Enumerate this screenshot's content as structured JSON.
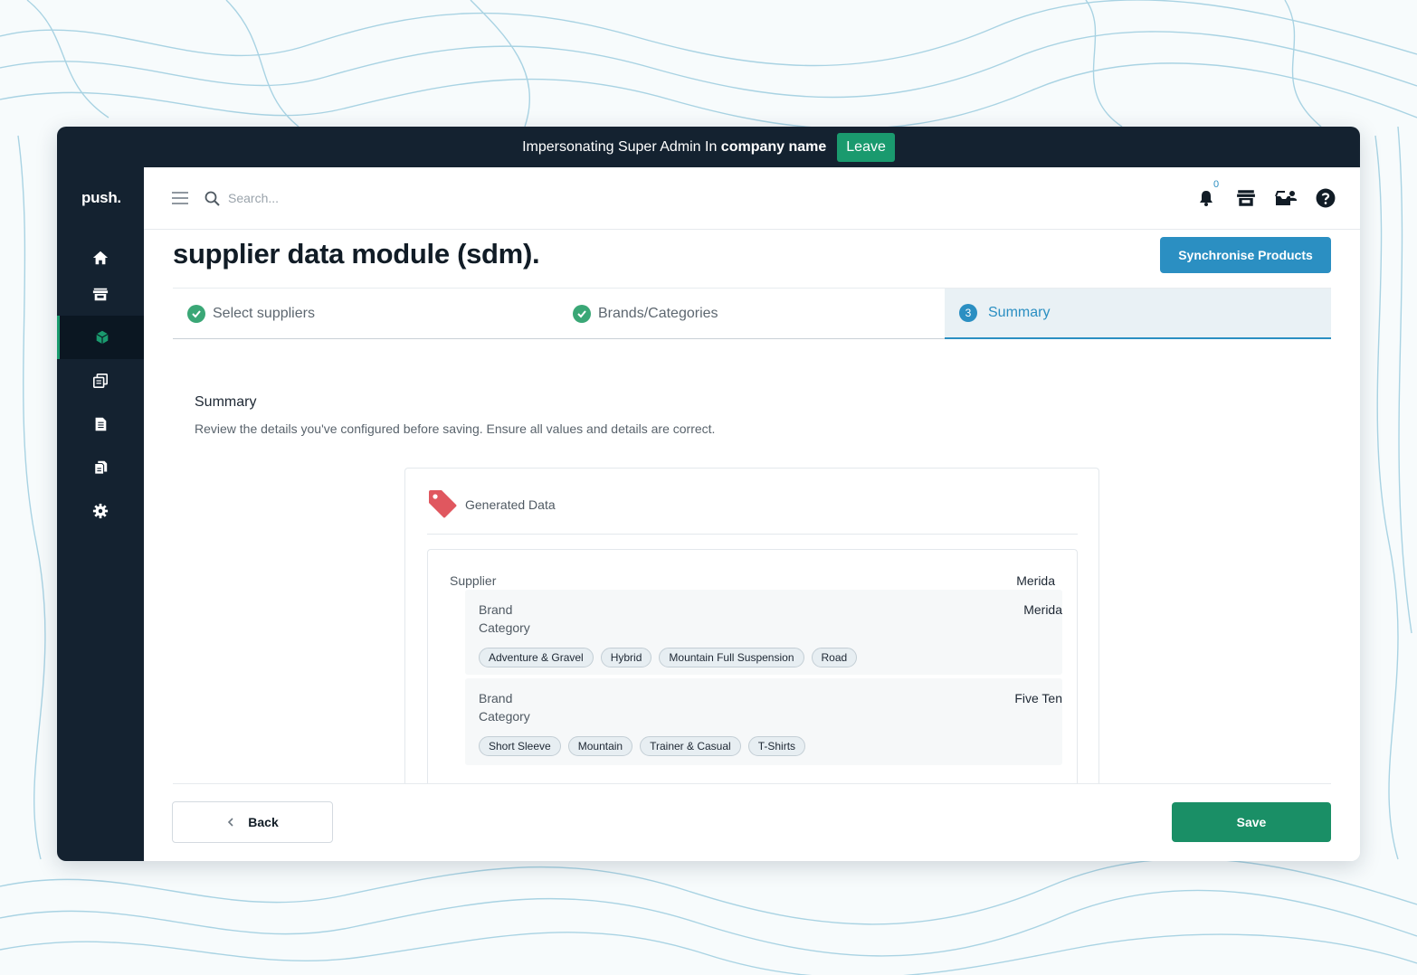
{
  "impersonation": {
    "text": "Impersonating Super Admin In",
    "company": "company name",
    "leave_label": "Leave"
  },
  "brand": {
    "logo": "push."
  },
  "sidebar": {
    "items": [
      {
        "icon": "home-icon"
      },
      {
        "icon": "store-icon"
      },
      {
        "icon": "cube-icon",
        "active": true
      },
      {
        "icon": "copy-icon"
      },
      {
        "icon": "invoice-icon"
      },
      {
        "icon": "documents-icon"
      },
      {
        "icon": "gear-icon"
      }
    ]
  },
  "topbar": {
    "search_placeholder": "Search...",
    "notification_count": "0"
  },
  "page": {
    "title": "supplier data module (sdm).",
    "sync_label": "Synchronise Products"
  },
  "steps": [
    {
      "label": "Select suppliers",
      "status": "complete"
    },
    {
      "label": "Brands/Categories",
      "status": "complete"
    },
    {
      "number": "3",
      "label": "Summary",
      "status": "current"
    }
  ],
  "summary": {
    "title": "Summary",
    "description": "Review the details you've configured before saving. Ensure all values and details are correct."
  },
  "generated": {
    "header": "Generated Data",
    "supplier_label": "Supplier",
    "supplier_value": "Merida",
    "brands": [
      {
        "brand_label": "Brand",
        "brand_value": "Merida",
        "category_label": "Category",
        "categories": [
          "Adventure & Gravel",
          "Hybrid",
          "Mountain Full Suspension",
          "Road"
        ]
      },
      {
        "brand_label": "Brand",
        "brand_value": "Five Ten",
        "category_label": "Category",
        "categories": [
          "Short Sleeve",
          "Mountain",
          "Trainer & Casual",
          "T-Shirts"
        ]
      }
    ]
  },
  "footer": {
    "back_label": "Back",
    "save_label": "Save"
  },
  "colors": {
    "dark_navy": "#142230",
    "accent_green": "#1a9a6e",
    "accent_blue": "#2b8fc2",
    "tag_red": "#e0575f"
  }
}
